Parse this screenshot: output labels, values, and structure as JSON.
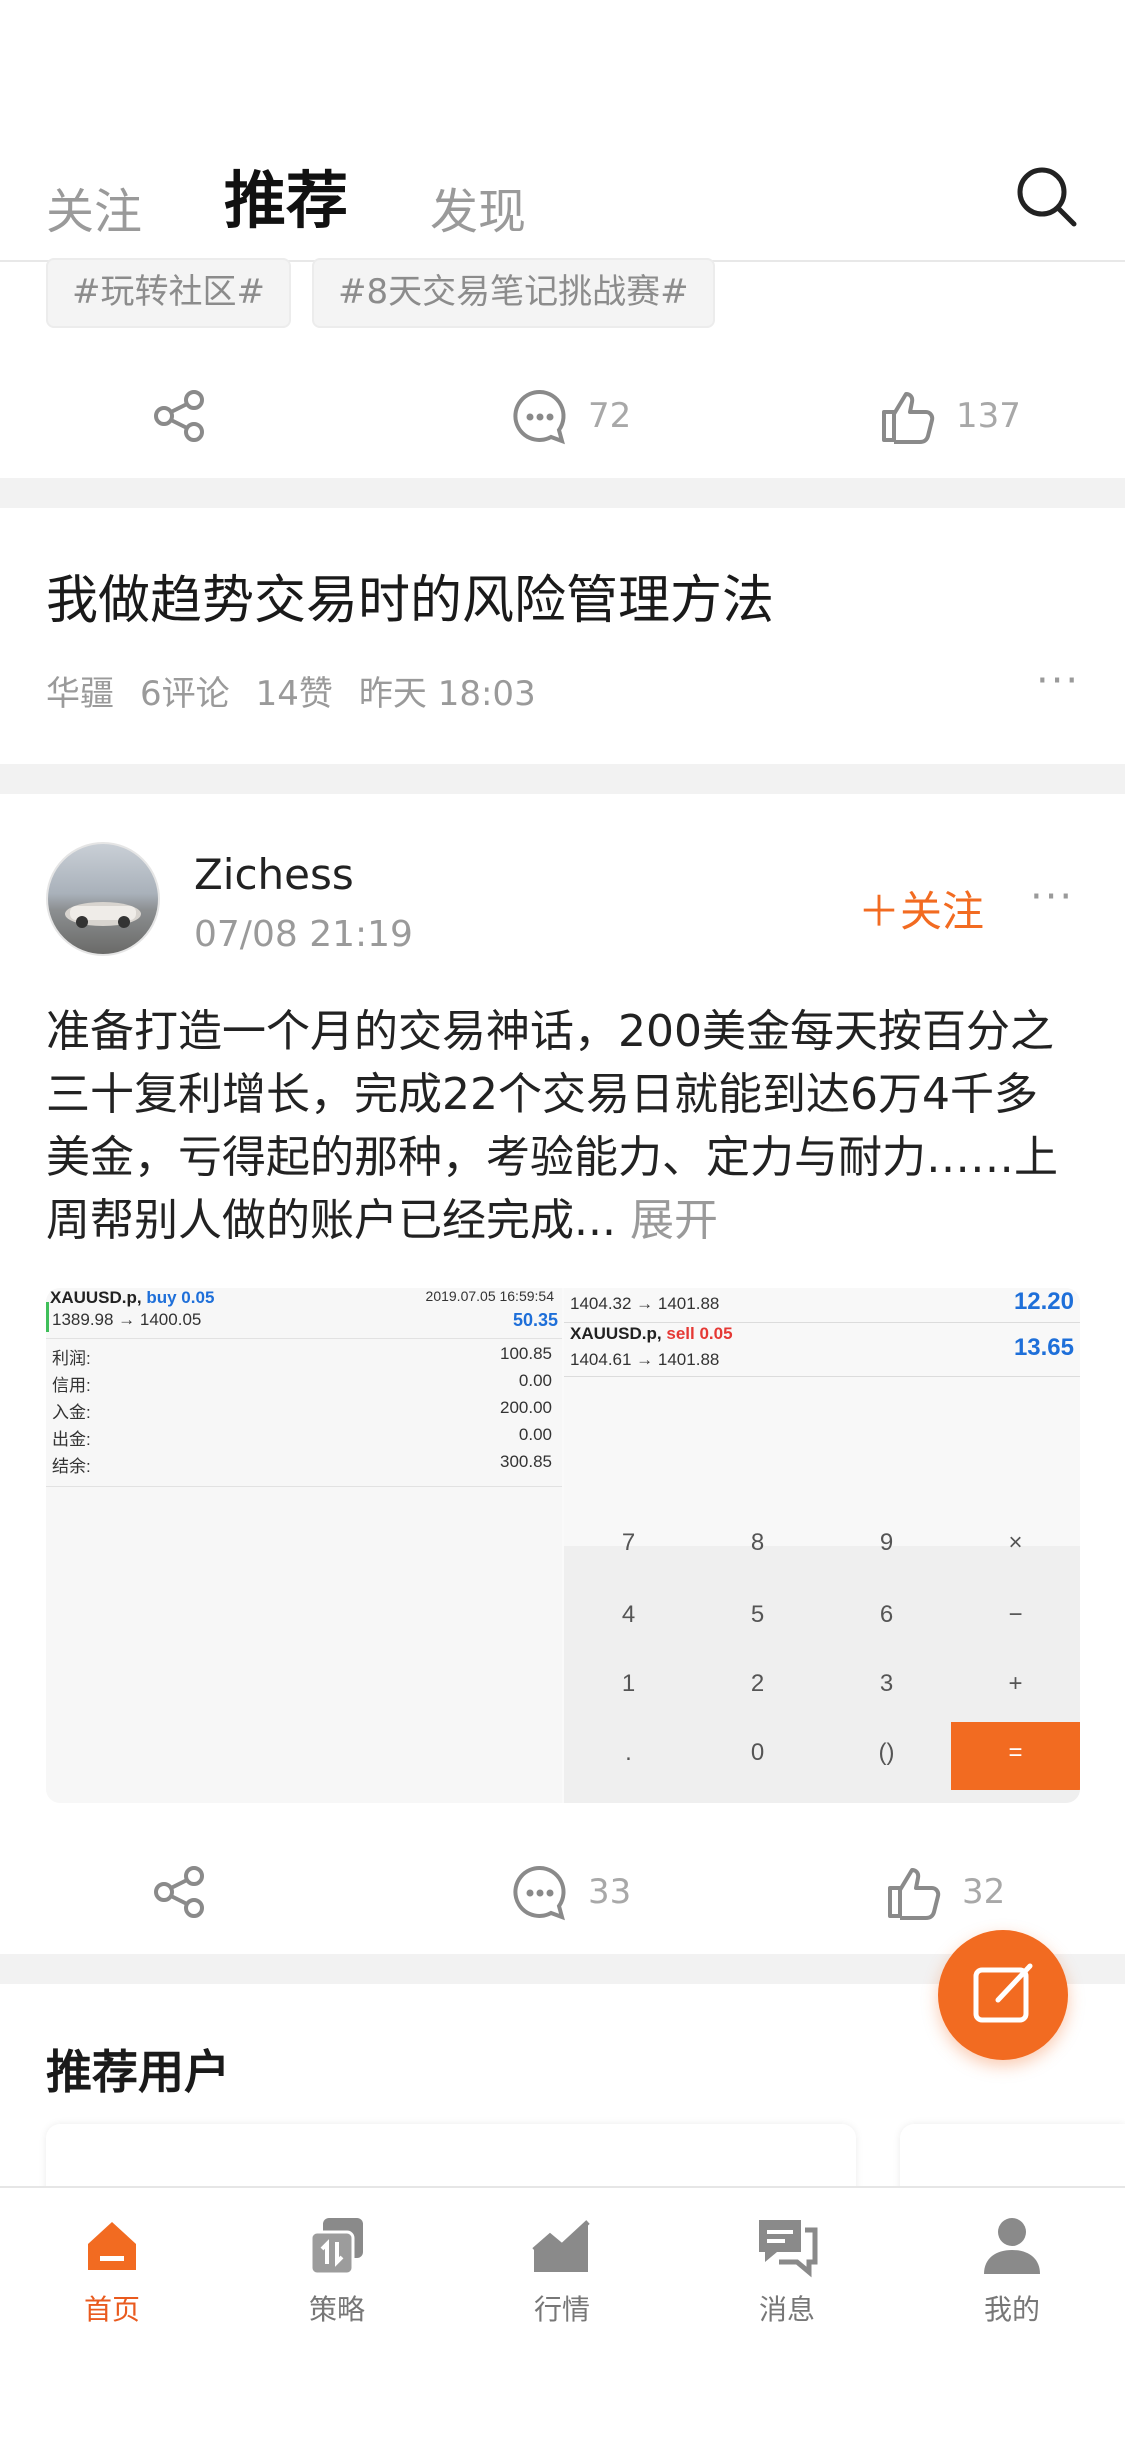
{
  "header": {
    "tabs": [
      {
        "label": "关注",
        "active": false
      },
      {
        "label": "推荐",
        "active": true
      },
      {
        "label": "发现",
        "active": false
      }
    ],
    "search_icon": "search-icon"
  },
  "tags": [
    "#玩转社区#",
    "#8天交易笔记挑战赛#"
  ],
  "first_post_actions": {
    "comments": "72",
    "likes": "137"
  },
  "article": {
    "title": "我做趋势交易时的风险管理方法",
    "author": "华疆",
    "comments": "6评论",
    "likes": "14赞",
    "time": "昨天 18:03"
  },
  "post": {
    "username": "Zichess",
    "time": "07/08 21:19",
    "follow_label": "关注",
    "text": "准备打造一个月的交易神话，200美金每天按百分之三十复利增长，完成22个交易日就能到达6万4千多美金，亏得起的那种，考验能力、定力与耐力……上周帮别人做的账户已经完成...",
    "more_label": "展开",
    "comments": "33",
    "likes": "32",
    "screenshot": {
      "left": {
        "trade_symbol": "XAUUSD.p,",
        "trade_side": "buy 0.05",
        "trade_date": "2019.07.05 16:59:54",
        "trade_prices": "1389.98 → 1400.05",
        "trade_profit": "50.35",
        "rows": [
          {
            "label": "利润:",
            "value": "100.85"
          },
          {
            "label": "信用:",
            "value": "0.00"
          },
          {
            "label": "入金:",
            "value": "200.00"
          },
          {
            "label": "出金:",
            "value": "0.00"
          },
          {
            "label": "结余:",
            "value": "300.85"
          }
        ]
      },
      "right": {
        "row1_prices": "1404.32 → 1401.88",
        "row1_profit": "12.20",
        "row2_symbol": "XAUUSD.p,",
        "row2_side": "sell 0.05",
        "row2_prices": "1404.61 → 1401.88",
        "row2_profit": "13.65",
        "keys": [
          "7",
          "8",
          "9",
          "×",
          "4",
          "5",
          "6",
          "−",
          "1",
          "2",
          "3",
          "+",
          ".",
          "0",
          "()",
          "="
        ]
      }
    }
  },
  "recommended_users": {
    "title": "推荐用户"
  },
  "bottom_nav": [
    {
      "label": "首页",
      "icon": "home-icon",
      "active": true
    },
    {
      "label": "策略",
      "icon": "strategy-icon",
      "active": false
    },
    {
      "label": "行情",
      "icon": "market-chart-icon",
      "active": false
    },
    {
      "label": "消息",
      "icon": "message-icon",
      "active": false
    },
    {
      "label": "我的",
      "icon": "profile-icon",
      "active": false
    }
  ],
  "colors": {
    "accent": "#F26B21",
    "muted": "#9A9A9A",
    "separator": "#F2F2F2",
    "buy_blue": "#1E6FD9",
    "sell_red": "#E53935"
  }
}
